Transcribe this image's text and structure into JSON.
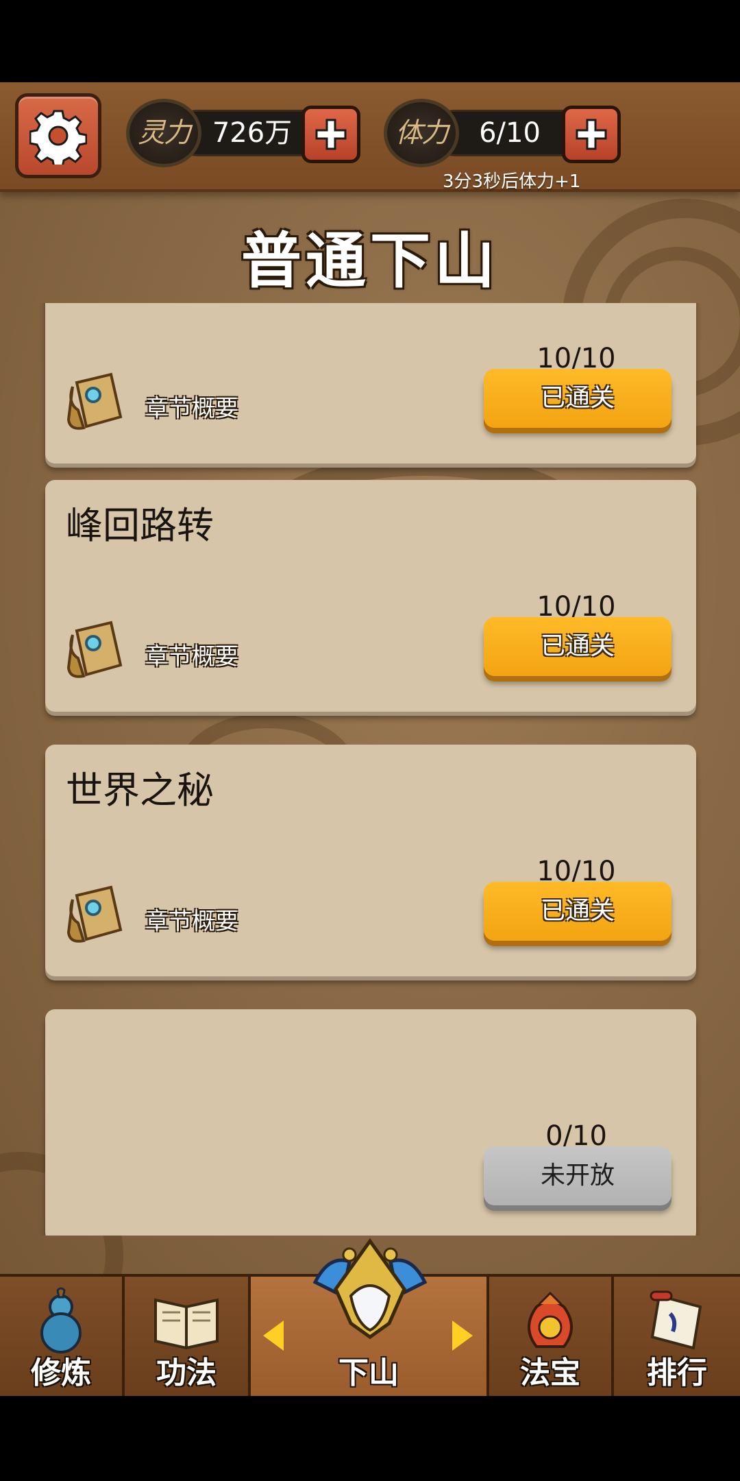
{
  "header": {
    "settings_icon": "gear-icon",
    "spirit": {
      "emblem": "灵力",
      "value": "726万"
    },
    "stamina": {
      "emblem": "体力",
      "value": "6/10",
      "timer": "3分3秒后体力+1"
    }
  },
  "page": {
    "title": "普通下山"
  },
  "chapters": [
    {
      "title": "",
      "summary_label": "章节概要",
      "progress": "10/10",
      "status": "已通关"
    },
    {
      "title": "峰回路转",
      "summary_label": "章节概要",
      "progress": "10/10",
      "status": "已通关"
    },
    {
      "title": "世界之秘",
      "summary_label": "章节概要",
      "progress": "10/10",
      "status": "已通关"
    },
    {
      "title": "",
      "summary_label": "",
      "progress": "0/10",
      "status": "未开放"
    }
  ],
  "nav": {
    "items": [
      {
        "label": "修炼",
        "icon": "gourd-icon"
      },
      {
        "label": "功法",
        "icon": "book-icon"
      },
      {
        "label": "下山",
        "icon": "mountain-emblem-icon"
      },
      {
        "label": "法宝",
        "icon": "treasure-bag-icon"
      },
      {
        "label": "排行",
        "icon": "scroll-icon"
      }
    ]
  },
  "colors": {
    "accent_button": "#f3a412",
    "locked_button": "#b2b2b2",
    "card_bg": "#d6c5a8",
    "header_bg": "#7a4b24"
  }
}
